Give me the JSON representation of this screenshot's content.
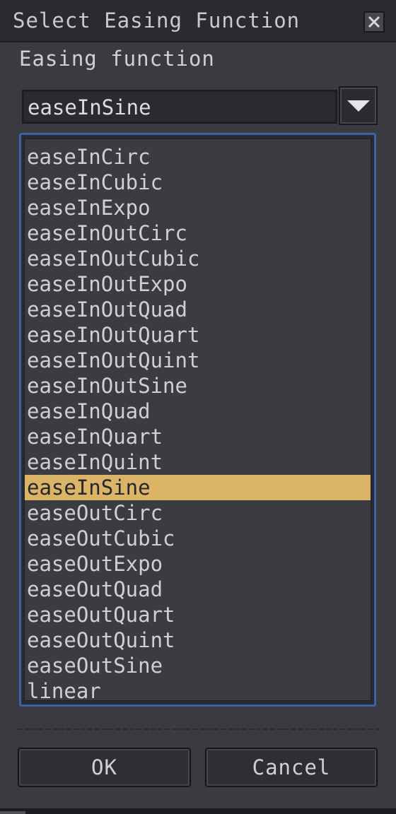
{
  "dialog": {
    "title": "Select Easing Function",
    "close_icon": "close-icon"
  },
  "section": {
    "label": "Easing function"
  },
  "combo": {
    "value": "easeInSine",
    "arrow_icon": "chevron-down-icon"
  },
  "list": {
    "selected_index": 13,
    "items": [
      "easeInCirc",
      "easeInCubic",
      "easeInExpo",
      "easeInOutCirc",
      "easeInOutCubic",
      "easeInOutExpo",
      "easeInOutQuad",
      "easeInOutQuart",
      "easeInOutQuint",
      "easeInOutSine",
      "easeInQuad",
      "easeInQuart",
      "easeInQuint",
      "easeInSine",
      "easeOutCirc",
      "easeOutCubic",
      "easeOutExpo",
      "easeOutQuad",
      "easeOutQuart",
      "easeOutQuint",
      "easeOutSine",
      "linear"
    ]
  },
  "buttons": {
    "ok_label": "OK",
    "cancel_label": "Cancel"
  },
  "colors": {
    "selection": "#dcb468",
    "focus_border": "#3f5fa8",
    "panel": "#3a3b40"
  }
}
